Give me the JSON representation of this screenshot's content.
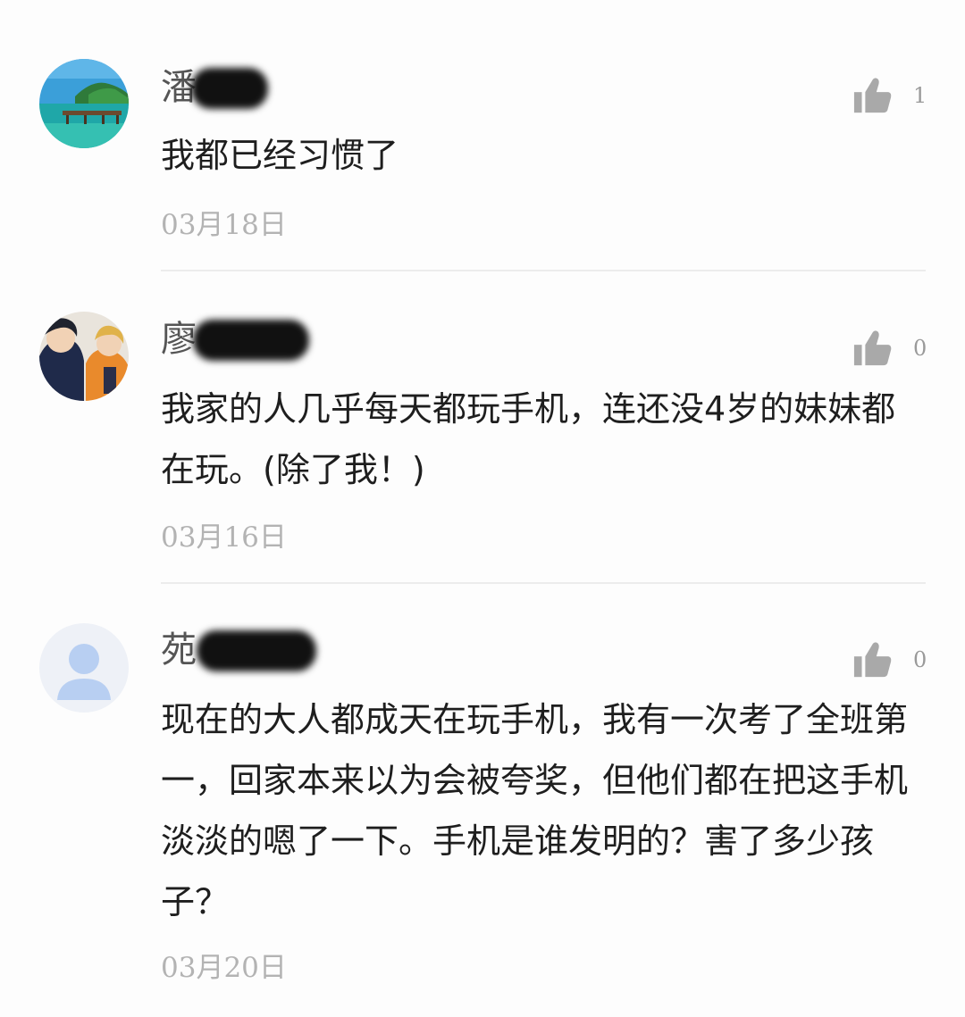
{
  "comments": [
    {
      "user": "潘",
      "avatar": "beach-pier-avatar",
      "likes": "1",
      "text": "我都已经习惯了",
      "date": "03月18日"
    },
    {
      "user": "廖",
      "avatar": "anime-characters-avatar",
      "likes": "0",
      "text": "我家的人几乎每天都玩手机，连还没4岁的妹妹都在玩。(除了我！)",
      "date": "03月16日"
    },
    {
      "user": "苑",
      "avatar": "default-user-avatar",
      "likes": "0",
      "text": "现在的大人都成天在玩手机，我有一次考了全班第一，回家本来以为会被夸奖，但他们都在把这手机淡淡的嗯了一下。手机是谁发明的？害了多少孩子？",
      "date": "03月20日"
    }
  ],
  "colors": {
    "background": "#fdfdfd",
    "text": "#1e1e1e",
    "username": "#555555",
    "date": "#b3b3b3",
    "like_icon": "#a9a9a9",
    "divider": "#ececec"
  }
}
